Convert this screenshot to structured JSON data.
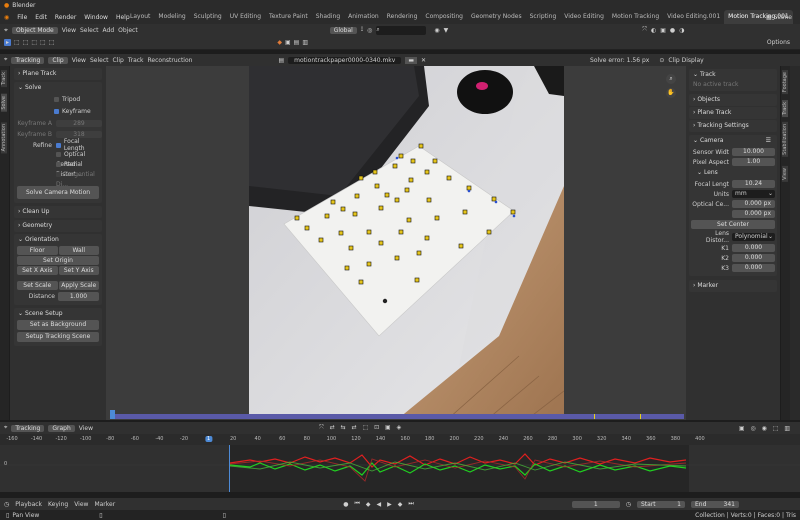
{
  "app": {
    "title": "Blender"
  },
  "menu": [
    "File",
    "Edit",
    "Render",
    "Window",
    "Help"
  ],
  "workspaces": [
    "Layout",
    "Modeling",
    "Sculpting",
    "UV Editing",
    "Texture Paint",
    "Shading",
    "Animation",
    "Rendering",
    "Compositing",
    "Geometry Nodes",
    "Scripting",
    "Video Editing",
    "Motion Tracking",
    "Video Editing.001",
    "Motion Tracking.001"
  ],
  "active_workspace": "Motion Tracking.001",
  "scene": "Scene",
  "viewport_header": {
    "mode": "Object Mode",
    "menus": [
      "View",
      "Select",
      "Add",
      "Object"
    ],
    "orientation": "Global",
    "options": "Options"
  },
  "clip_header": {
    "editor": "Tracking",
    "view": "Clip",
    "menus": [
      "View",
      "Select",
      "Clip",
      "Track",
      "Reconstruction"
    ],
    "filename": "motiontrackpaper0000-0340.mkv",
    "solve_error": "Solve error: 1.56 px",
    "display": "Clip Display"
  },
  "left_panel": {
    "vtabs": [
      "Track",
      "Solve",
      "Annotation"
    ],
    "plane_track": "Plane Track",
    "solve": {
      "title": "Solve",
      "tripod": "Tripod",
      "keyframe": "Keyframe",
      "keyframe_a_label": "Keyframe A",
      "keyframe_a": "289",
      "keyframe_b_label": "Keyframe B",
      "keyframe_b": "318",
      "refine": "Refine",
      "refine_opts": [
        "Focal Length",
        "Optical Center",
        "Radial Distort...",
        "Tangential Di..."
      ],
      "solve_button": "Solve Camera Motion"
    },
    "cleanup": "Clean Up",
    "geometry": "Geometry",
    "orientation": {
      "title": "Orientation",
      "floor": "Floor",
      "wall": "Wall",
      "set_origin": "Set Origin",
      "set_x": "Set X Axis",
      "set_y": "Set Y Axis",
      "set_scale": "Set Scale",
      "apply_scale": "Apply Scale",
      "distance_label": "Distance",
      "distance": "1.000"
    },
    "scene_setup": {
      "title": "Scene Setup",
      "bg": "Set as Background",
      "setup": "Setup Tracking Scene"
    }
  },
  "right_panel": {
    "vtabs": [
      "Footage",
      "Track",
      "Stabilization",
      "View"
    ],
    "track": "Track",
    "no_active": "No active track",
    "objects": "Objects",
    "plane_track": "Plane Track",
    "tracking_settings": "Tracking Settings",
    "camera": "Camera",
    "sensor_label": "Sensor Widt",
    "sensor": "10.000",
    "aspect_label": "Pixel Aspect",
    "aspect": "1.00",
    "lens": "Lens",
    "focal_label": "Focal Lengt",
    "focal": "10.24",
    "units_label": "Units",
    "units": "mm",
    "optical_label": "Optical Ce...",
    "optical_x": "0.000 px",
    "optical_y": "0.000 px",
    "set_center": "Set Center",
    "distortion_label": "Lens Distor...",
    "distortion": "Polynomial",
    "k1_label": "K1",
    "k1": "0.000",
    "k2_label": "K2",
    "k2": "0.000",
    "k3_label": "K3",
    "k3": "0.000",
    "marker": "Marker"
  },
  "graph_header": {
    "editor": "Tracking",
    "view": "Graph",
    "menu": "View"
  },
  "graph_ticks": [
    "-160",
    "-140",
    "-120",
    "-100",
    "-80",
    "-60",
    "-40",
    "-20",
    "1",
    "20",
    "40",
    "60",
    "80",
    "100",
    "120",
    "140",
    "160",
    "180",
    "200",
    "220",
    "240",
    "260",
    "280",
    "300",
    "320",
    "340",
    "360",
    "380",
    "400"
  ],
  "graph_y": "0",
  "timeline": {
    "playback": "Playback",
    "keying": "Keying",
    "view": "View",
    "marker": "Marker",
    "current": "1",
    "start_label": "Start",
    "start": "1",
    "end_label": "End",
    "end": "341"
  },
  "status": {
    "left": "Pan View",
    "right": "Collection | Verts:0 | Faces:0 | Tris"
  },
  "colors": {
    "accent": "#4a7bd0",
    "active_frame": "#4d8ad6",
    "curve_red": "#e02020",
    "curve_green": "#20d020",
    "frame_bar": "#5a5aa8"
  }
}
